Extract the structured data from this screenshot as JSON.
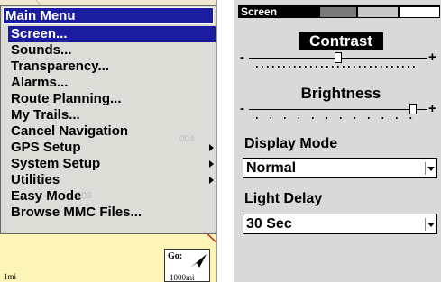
{
  "main_menu": {
    "title": "Main Menu",
    "items": [
      {
        "label": "Screen...",
        "selected": true,
        "submenu": false
      },
      {
        "label": "Sounds...",
        "selected": false,
        "submenu": false
      },
      {
        "label": "Transparency...",
        "selected": false,
        "submenu": false
      },
      {
        "label": "Alarms...",
        "selected": false,
        "submenu": false
      },
      {
        "label": "Route Planning...",
        "selected": false,
        "submenu": false
      },
      {
        "label": "My Trails...",
        "selected": false,
        "submenu": false
      },
      {
        "label": "Cancel Navigation",
        "selected": false,
        "submenu": false
      },
      {
        "label": "GPS Setup",
        "selected": false,
        "submenu": true
      },
      {
        "label": "System Setup",
        "selected": false,
        "submenu": true
      },
      {
        "label": "Utilities",
        "selected": false,
        "submenu": true
      },
      {
        "label": "Easy Mode",
        "selected": false,
        "submenu": false
      },
      {
        "label": "Browse MMC Files...",
        "selected": false,
        "submenu": false
      }
    ],
    "highlight_color": "#1c1ca0"
  },
  "map": {
    "scale_label": "1mi",
    "goto_label": "Go:",
    "goto_distance": "1000mi",
    "waypoint_labels": [
      "003",
      "004"
    ],
    "background_color": "#ede8cf"
  },
  "screen_panel": {
    "title": "Screen",
    "contrast": {
      "label": "Contrast",
      "level": 0.5
    },
    "brightness": {
      "label": "Brightness",
      "level": 0.92
    },
    "minus_sign": "-",
    "plus_sign": "+",
    "display_mode": {
      "label": "Display Mode",
      "value": "Normal"
    },
    "light_delay": {
      "label": "Light Delay",
      "value": "30 Sec"
    }
  }
}
